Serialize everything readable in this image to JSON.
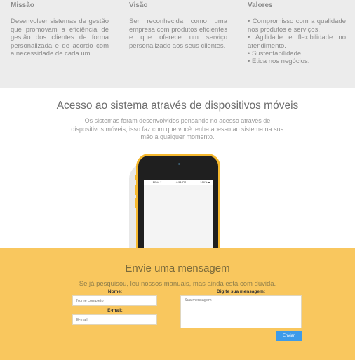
{
  "about": {
    "mission": {
      "title": "Missão",
      "text": "Desenvolver sistemas de gestão que promovam a eficiência de gestão dos clientes de forma personalizada e de acordo com a necessidade de cada um."
    },
    "vision": {
      "title": "Visão",
      "text": "Ser reconhecida como uma empresa com produtos eficientes e que oferece um serviço personalizado aos seus clientes."
    },
    "values": {
      "title": "Valores",
      "items": [
        "• Compromisso com a qualidade nos produtos e serviços.",
        "• Agilidade e flexibilidade no atendimento.",
        "• Sustentabilidade.",
        "• Ética nos negócios."
      ]
    }
  },
  "mobile": {
    "title": "Acesso ao sistema através de dispositivos móveis",
    "description": "Os sistemas foram desenvolvidos pensando no acesso através de dispositivos móveis, isso faz com que você tenha acesso ao sistema na sua mão a qualquer momento.",
    "phone_status": {
      "carrier": "•••• BELL ⌔",
      "time": "4:21 PM",
      "battery": "100% ▬"
    }
  },
  "contact": {
    "title": "Envie uma mensagem",
    "subtitle": "Se já pesquisou, leu nossos manuais, mas ainda está com dúvida.",
    "name_label": "Nome:",
    "name_placeholder": "Nome completo",
    "email_label": "E-mail:",
    "email_placeholder": "E-mail",
    "message_label": "Digite sua mensagem:",
    "message_placeholder": "Sua mensagem",
    "send_label": "Enviar"
  },
  "colors": {
    "top_bg": "#ececec",
    "contact_bg": "#f9c75e",
    "phone_body": "#f5b82e",
    "send_button": "#3d9be9"
  }
}
